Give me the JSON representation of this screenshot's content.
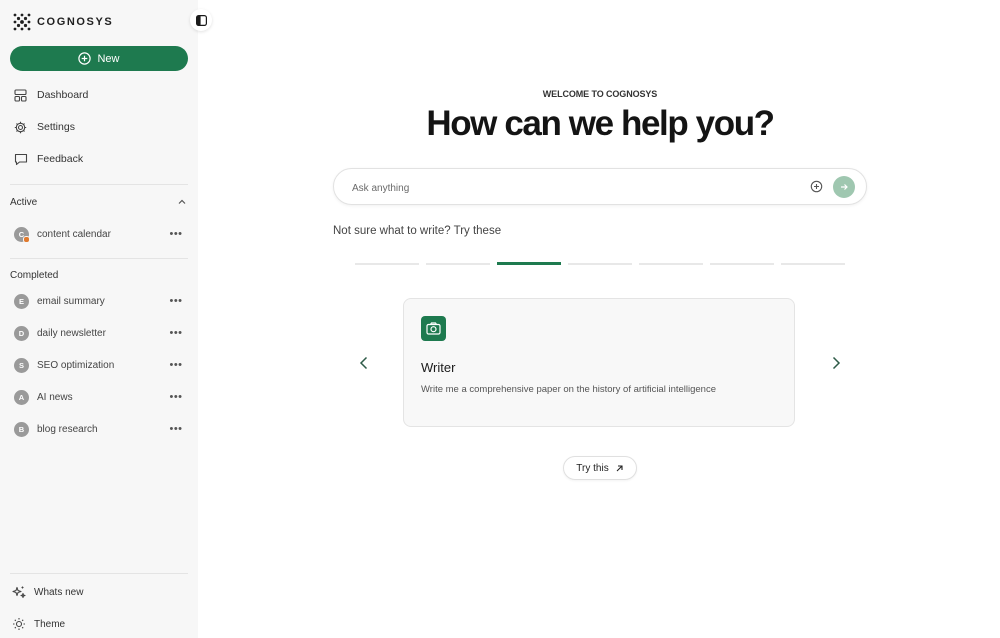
{
  "brand": {
    "name": "COGNOSYS",
    "accent_color": "#1e7a4f"
  },
  "sidebar": {
    "new_label": "New",
    "nav": [
      {
        "label": "Dashboard",
        "icon": "dashboard-icon"
      },
      {
        "label": "Settings",
        "icon": "gear-icon"
      },
      {
        "label": "Feedback",
        "icon": "chat-icon"
      }
    ],
    "active_heading": "Active",
    "active_tasks": [
      {
        "initial": "C",
        "label": "content calendar",
        "status_dot": true
      }
    ],
    "completed_heading": "Completed",
    "completed_tasks": [
      {
        "initial": "E",
        "label": "email summary"
      },
      {
        "initial": "D",
        "label": "daily newsletter"
      },
      {
        "initial": "S",
        "label": "SEO optimization"
      },
      {
        "initial": "A",
        "label": "AI news"
      },
      {
        "initial": "B",
        "label": "blog research"
      }
    ],
    "bottom": [
      {
        "label": "Whats new",
        "icon": "sparkle-icon"
      },
      {
        "label": "Theme",
        "icon": "sun-icon"
      }
    ]
  },
  "main": {
    "welcome": "WELCOME TO COGNOSYS",
    "headline": "How can we help you?",
    "search_placeholder": "Ask anything",
    "hint": "Not sure what to write? Try these",
    "carousel_total": 7,
    "carousel_active": 2,
    "card": {
      "title": "Writer",
      "description": "Write me a comprehensive paper on the history of artificial intelligence",
      "icon": "camera-icon"
    },
    "try_label": "Try this"
  }
}
